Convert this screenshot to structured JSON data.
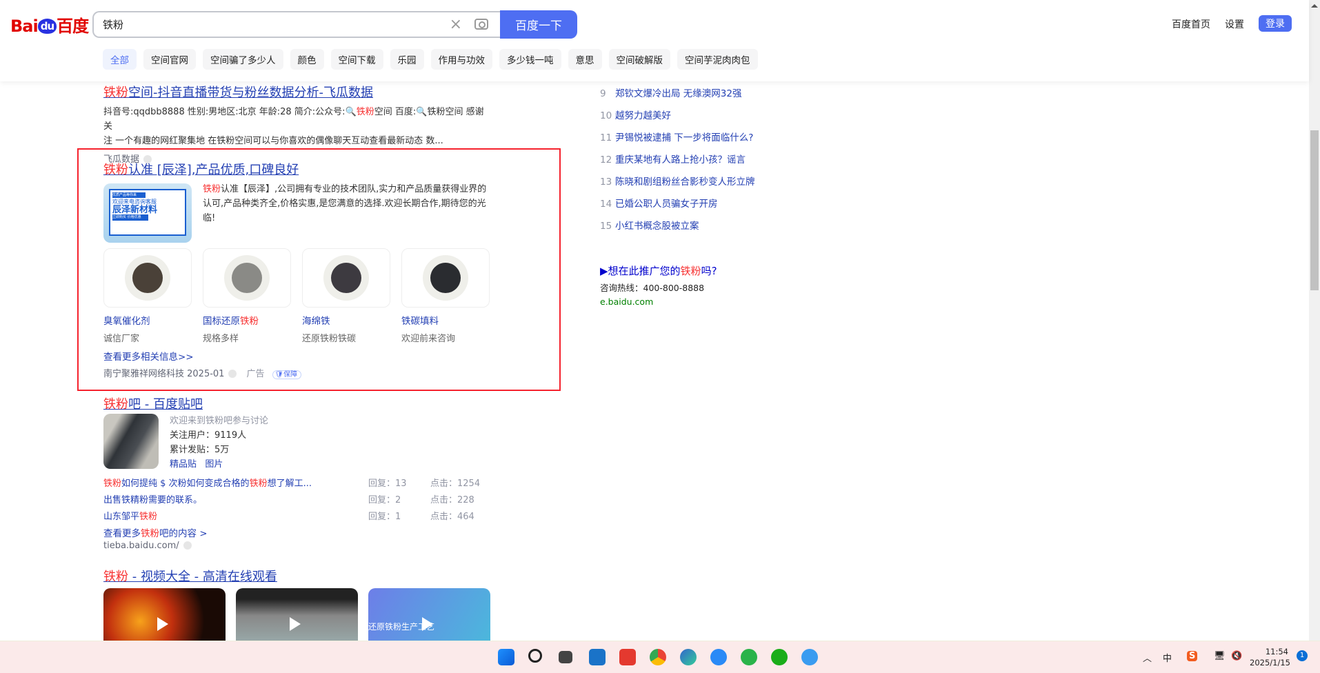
{
  "header": {
    "logo": "Bai du 百度",
    "logo_parts": [
      "Bai",
      "du",
      "百度"
    ],
    "search_value": "铁粉",
    "search_button": "百度一下",
    "links": [
      "百度首页",
      "设置"
    ],
    "login": "登录"
  },
  "tabs": [
    "全部",
    "空间官网",
    "空间骗了多少人",
    "颜色",
    "空间下载",
    "乐园",
    "作用与功效",
    "多少钱一吨",
    "意思",
    "空间破解版",
    "空间芋泥肉肉包"
  ],
  "result1": {
    "title_hl": "铁粉",
    "title_rest": "空间-抖音直播带货与粉丝数据分析-飞瓜数据",
    "desc1_a": "抖音号:qqdbb8888 性别:男地区:北京 年龄:28 简介:公众号:🔍",
    "desc1_hl": "铁粉",
    "desc1_b": "空间 百度:🔍铁粉空间 感谢关",
    "desc2": "注 一个有趣的网红聚集地 在铁粉空间可以与你喜欢的偶像聊天互动查看最新动态 数...",
    "source": "飞瓜数据"
  },
  "ad": {
    "title_hl": "铁粉",
    "title_rest": "认准 [辰泽],产品优质,口碑良好",
    "desc_hl": "铁粉",
    "desc_rest": "认准【辰泽】,公司拥有专业的技术团队,实力和产品质量获得业界的认可,产品种类齐全,价格实惠,是您满意的选择.欢迎长期合作,期待您的光临!",
    "banner": {
      "tag": "优质产品等你来",
      "line1": "欢迎来电咨询客服",
      "line2": "辰泽新材料",
      "btn": "立即购买 价格优惠"
    },
    "products": [
      {
        "name": "臭氧催化剂",
        "name_hl": "",
        "sub": "诚信厂家",
        "color": "#4a4138"
      },
      {
        "name": "国标还原",
        "name_hl": "铁粉",
        "sub": "规格多样",
        "color": "#8a8a86"
      },
      {
        "name": "海绵铁",
        "name_hl": "",
        "sub": "还原铁粉铁碳",
        "color": "#3d3a40"
      },
      {
        "name": "铁碳填料",
        "name_hl": "",
        "sub": "欢迎前来咨询",
        "color": "#2a2c30"
      }
    ],
    "more": "查看更多相关信息>>",
    "source": "南宁聚雅祥网络科技 2025-01",
    "ad_label": "广告",
    "badge": "保障"
  },
  "tieba": {
    "title_hl": "铁粉",
    "title_rest": "吧 - 百度贴吧",
    "welcome": "欢迎来到铁粉吧参与讨论",
    "followers": "关注用户：9119人",
    "posts": "累计发贴：5万",
    "links": [
      "精品贴",
      "图片"
    ],
    "threads": [
      {
        "parts": [
          [
            "铁粉",
            true
          ],
          [
            "如何提纯 $ 次粉如何变成合格的",
            false
          ],
          [
            "铁粉",
            true
          ],
          [
            "想了解工...",
            false
          ]
        ],
        "reply": "回复：13",
        "clicks": "点击：1254"
      },
      {
        "parts": [
          [
            "出售铁精粉需要的联系。",
            false
          ]
        ],
        "reply": "回复：2",
        "clicks": "点击：228"
      },
      {
        "parts": [
          [
            "山东邹平",
            false
          ],
          [
            "铁粉",
            true
          ]
        ],
        "reply": "回复：1",
        "clicks": "点击：464"
      }
    ],
    "more_a": "查看更多",
    "more_hl": "铁粉",
    "more_b": "吧的内容 >",
    "source": "tieba.baidu.com/"
  },
  "video": {
    "title_hl": "铁粉",
    "title_rest": " - 视频大全 - 高清在线观看",
    "thumb3_text": "还原铁粉生产工艺"
  },
  "hot": [
    {
      "n": "9",
      "t": "郑钦文爆冷出局 无缘澳网32强"
    },
    {
      "n": "10",
      "t": "越努力越美好"
    },
    {
      "n": "11",
      "t": "尹锡悦被逮捕 下一步将面临什么?"
    },
    {
      "n": "12",
      "t": "重庆某地有人路上抢小孩？谣言"
    },
    {
      "n": "13",
      "t": "陈晓和剧组粉丝合影秒变人形立牌"
    },
    {
      "n": "14",
      "t": "已婚公职人员骗女子开房"
    },
    {
      "n": "15",
      "t": "小红书概念股被立案"
    }
  ],
  "promo": {
    "a": "▶想在此推广您的",
    "hl": "铁粉",
    "b": "吗?",
    "hotline": "咨询热线：400-800-8888",
    "site": "e.baidu.com"
  },
  "taskbar": {
    "time": "11:54",
    "date": "2025/1/15",
    "notif": "1",
    "ime": "中"
  }
}
